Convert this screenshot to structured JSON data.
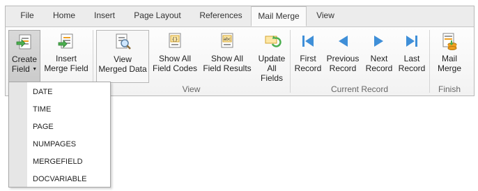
{
  "tabs": [
    {
      "label": "File"
    },
    {
      "label": "Home"
    },
    {
      "label": "Insert"
    },
    {
      "label": "Page Layout"
    },
    {
      "label": "References"
    },
    {
      "label": "Mail Merge",
      "active": true
    },
    {
      "label": "View"
    }
  ],
  "groups": {
    "insert_fields": {
      "create_field": {
        "line1": "Create",
        "line2": "Field",
        "icon": "create-field-icon"
      },
      "insert_merge_field": {
        "line1": "Insert",
        "line2": "Merge Field",
        "icon": "insert-merge-field-icon"
      }
    },
    "view": {
      "label": "View",
      "view_merged_data": {
        "line1": "View",
        "line2": "Merged Data",
        "icon": "view-merged-data-icon"
      },
      "show_all_field_codes": {
        "line1": "Show All",
        "line2": "Field Codes",
        "icon": "field-codes-icon",
        "badge": "{}"
      },
      "show_all_field_results": {
        "line1": "Show All",
        "line2": "Field Results",
        "icon": "field-results-icon",
        "badge": "abc"
      },
      "update_all_fields": {
        "line1": "Update",
        "line2": "All Fields",
        "icon": "update-fields-icon"
      }
    },
    "current_record": {
      "label": "Current Record",
      "first": {
        "line1": "First",
        "line2": "Record",
        "icon": "first-record-icon"
      },
      "previous": {
        "line1": "Previous",
        "line2": "Record",
        "icon": "previous-record-icon"
      },
      "next": {
        "line1": "Next",
        "line2": "Record",
        "icon": "next-record-icon"
      },
      "last": {
        "line1": "Last",
        "line2": "Record",
        "icon": "last-record-icon"
      }
    },
    "finish": {
      "label": "Finish",
      "mail_merge": {
        "line1": "Mail",
        "line2": "Merge",
        "icon": "mail-merge-icon"
      }
    }
  },
  "create_field_menu": {
    "items": [
      "DATE",
      "TIME",
      "PAGE",
      "NUMPAGES",
      "MERGEFIELD",
      "DOCVARIABLE"
    ]
  },
  "colors": {
    "nav_arrow": "#3f8fd8",
    "doc_green": "#4caf50",
    "doc_orange": "#f0a020"
  }
}
